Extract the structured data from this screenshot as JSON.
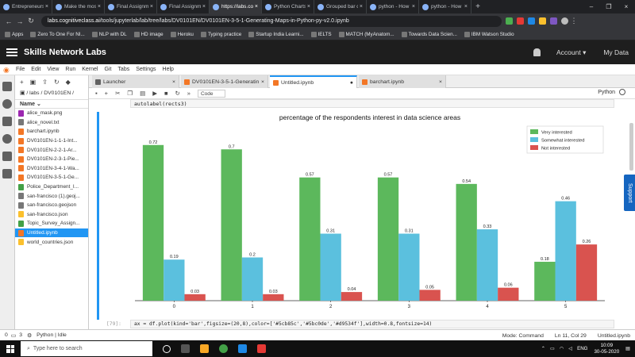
{
  "browser": {
    "tabs": [
      {
        "title": "Entrepreneurs",
        "active": false
      },
      {
        "title": "Make the most",
        "active": false
      },
      {
        "title": "Final Assignme",
        "active": false
      },
      {
        "title": "Final Assignme",
        "active": false
      },
      {
        "title": "https://labs.co",
        "active": true
      },
      {
        "title": "Python Charts",
        "active": false
      },
      {
        "title": "Grouped bar c",
        "active": false
      },
      {
        "title": "python - How",
        "active": false
      },
      {
        "title": "python - How",
        "active": false
      }
    ],
    "url_host": "labs.cognitiveclass.ai",
    "url_path": "/tools/jupyterlab/lab/tree/labs/DV0101EN/DV0101EN-3-5-1-Generating-Maps-in-Python-py-v2.0.ipynb",
    "bookmarks": [
      "Apps",
      "Zero To One For NI...",
      "NLP with DL",
      "HD image",
      "Heroku",
      "Typing practice",
      "Startup India Learni...",
      "IELTS",
      "MATCH (MyAnatom...",
      "Towards Data Scien...",
      "IBM Watson Studio"
    ]
  },
  "header": {
    "brand": "Skills Network Labs",
    "account": "Account",
    "my_data": "My Data"
  },
  "menu": [
    "File",
    "Edit",
    "View",
    "Run",
    "Kernel",
    "Git",
    "Tabs",
    "Settings",
    "Help"
  ],
  "filebrowser": {
    "path": "/ labs / DV0101EN /",
    "column": "Name",
    "files": [
      {
        "name": "alice_mask.png",
        "type": "img",
        "selected": false
      },
      {
        "name": "alice_novel.txt",
        "type": "txt",
        "selected": false
      },
      {
        "name": "barchart.ipynb",
        "type": "nb",
        "selected": false
      },
      {
        "name": "DV0101EN-1-1-1-Int...",
        "type": "nb",
        "selected": false
      },
      {
        "name": "DV0101EN-2-2-1-Ar...",
        "type": "nb",
        "selected": false
      },
      {
        "name": "DV0101EN-2-3-1-Pie...",
        "type": "nb",
        "selected": false
      },
      {
        "name": "DV0101EN-3-4-1-Wa...",
        "type": "nb",
        "selected": false
      },
      {
        "name": "DV0101EN-3-5-1-Ge...",
        "type": "nb",
        "selected": false
      },
      {
        "name": "Police_Department_I...",
        "type": "csv",
        "selected": false
      },
      {
        "name": "san-francisco (1).geoj...",
        "type": "txt",
        "selected": false
      },
      {
        "name": "san-francisco.geojson",
        "type": "txt",
        "selected": false
      },
      {
        "name": "san-francisco.json",
        "type": "json",
        "selected": false
      },
      {
        "name": "Topic_Survey_Assign...",
        "type": "csv",
        "selected": false
      },
      {
        "name": "Untitled.ipynb",
        "type": "nb",
        "selected": true
      },
      {
        "name": "world_countries.json",
        "type": "json",
        "selected": false
      }
    ]
  },
  "doctabs": [
    {
      "title": "Launcher",
      "active": false,
      "icon": "launcher"
    },
    {
      "title": "DV0101EN-3-5-1-Generatin",
      "active": false,
      "icon": "nb"
    },
    {
      "title": "Untitled.ipynb",
      "active": true,
      "icon": "nb"
    },
    {
      "title": "barchart.ipynb",
      "active": false,
      "icon": "nb"
    }
  ],
  "toolbar": {
    "cell_type": "Code",
    "kernel": "Python"
  },
  "code": {
    "top": "autolabel(rects3)",
    "prompt": "[79]:",
    "bottom": "ax = df.plot(kind='bar',figsize=(20,8),color=['#5cb85c','#5bc0de','#d9534f'],width=0.8,fontsize=14)"
  },
  "chart_data": {
    "type": "bar",
    "title": "percentage of the respondents interest in data science areas",
    "categories": [
      "0",
      "1",
      "2",
      "3",
      "4",
      "5"
    ],
    "series": [
      {
        "name": "Very interested",
        "color": "#5cb85c",
        "values": [
          0.72,
          0.7,
          0.57,
          0.57,
          0.54,
          0.18
        ]
      },
      {
        "name": "Somewhat interested",
        "color": "#5bc0de",
        "values": [
          0.19,
          0.2,
          0.31,
          0.31,
          0.33,
          0.46
        ]
      },
      {
        "name": "Not interested",
        "color": "#d9534f",
        "values": [
          0.03,
          0.03,
          0.04,
          0.05,
          0.06,
          0.26
        ]
      }
    ],
    "ylim": [
      0,
      0.8
    ],
    "legend": "top-right",
    "grid": false
  },
  "support": "Support",
  "statusbar": {
    "left_num1": "0",
    "left_num2": "3",
    "kernel_status": "Python | Idle",
    "mode": "Mode: Command",
    "position": "Ln 11, Col 29",
    "file": "Untitled.ipynb"
  },
  "taskbar": {
    "search": "Type here to search",
    "lang": "ENG",
    "time": "10:09",
    "date": "30-05-2020"
  }
}
